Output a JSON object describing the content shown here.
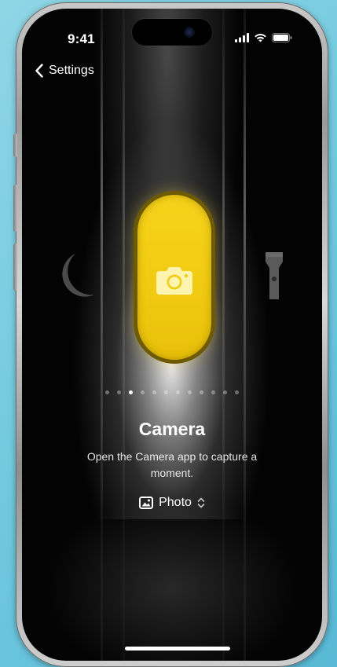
{
  "status": {
    "time": "9:41"
  },
  "nav": {
    "back_label": "Settings"
  },
  "action": {
    "title": "Camera",
    "description": "Open the Camera app to capture a moment.",
    "mode_label": "Photo",
    "accent_color": "#f2cc12"
  },
  "pager": {
    "total": 12,
    "active_index": 2
  },
  "icons": {
    "left": "moon-icon",
    "center": "camera-icon",
    "right": "flashlight-icon",
    "mode": "photo-icon",
    "mode_chevron": "chevron-up-down-icon"
  }
}
